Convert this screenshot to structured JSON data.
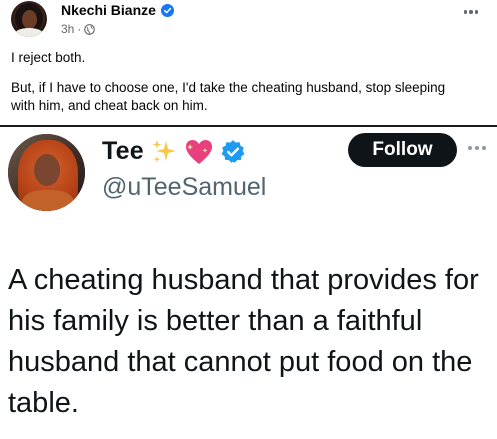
{
  "facebook_post": {
    "author_name": "Nkechi Bianze",
    "time": "3h",
    "separator": "·",
    "audience_icon": "globe-icon",
    "verified_icon": "verified-badge-icon",
    "more_icon": "more-options-icon",
    "paragraph_1": "I reject both.",
    "paragraph_2": "But, if I have to choose one, I'd take the cheating husband, stop sleeping with him, and cheat back on him.",
    "verified_color": "#1877f2"
  },
  "tweet": {
    "display_name": "Tee",
    "name_emojis": [
      "sparkles-icon",
      "sparkling-heart-icon"
    ],
    "verified_icon": "verified-badge-icon",
    "handle": "@uTeeSamuel",
    "follow_label": "Follow",
    "more_icon": "more-options-icon",
    "text": "A cheating husband that provides for his family is better than a faithful husband that cannot put food on the table.",
    "verified_color": "#1d9bf0",
    "follow_button_color": "#0f1419"
  }
}
